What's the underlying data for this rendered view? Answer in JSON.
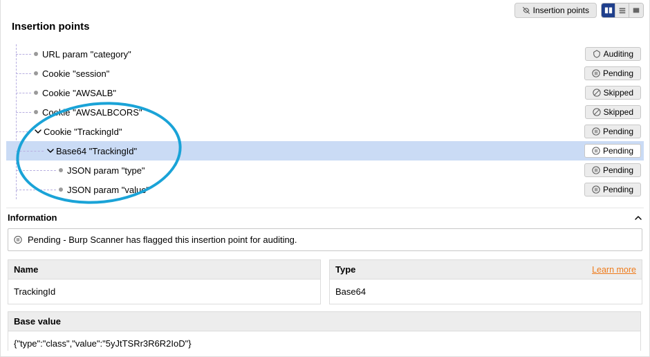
{
  "header": {
    "title": "Insertion points",
    "insertion_points_btn": "Insertion points"
  },
  "tree": [
    {
      "indent": 40,
      "dot": "gray",
      "caret": false,
      "label": "URL param \"category\"",
      "status": "Auditing",
      "status_icon": "auditing"
    },
    {
      "indent": 40,
      "dot": "gray",
      "caret": false,
      "label": "Cookie \"session\"",
      "status": "Pending",
      "status_icon": "pending"
    },
    {
      "indent": 40,
      "dot": "gray",
      "caret": false,
      "label": "Cookie \"AWSALB\"",
      "status": "Skipped",
      "status_icon": "skipped"
    },
    {
      "indent": 40,
      "dot": "gray",
      "caret": false,
      "label": "Cookie \"AWSALBCORS\"",
      "status": "Skipped",
      "status_icon": "skipped"
    },
    {
      "indent": 40,
      "dot": "purple",
      "caret": true,
      "label": "Cookie \"TrackingId\"",
      "status": "Pending",
      "status_icon": "pending"
    },
    {
      "indent": 58,
      "dot": "purple",
      "caret": true,
      "label": "Base64 \"TrackingId\"",
      "status": "Pending",
      "status_icon": "pending",
      "highlight": true
    },
    {
      "indent": 76,
      "dot": "gray",
      "caret": false,
      "label": "JSON param \"type\"",
      "status": "Pending",
      "status_icon": "pending"
    },
    {
      "indent": 76,
      "dot": "gray",
      "caret": false,
      "label": "JSON param \"value\"",
      "status": "Pending",
      "status_icon": "pending"
    }
  ],
  "info": {
    "header": "Information",
    "pending_msg": "Pending - Burp Scanner has flagged this insertion point for auditing.",
    "name_label": "Name",
    "name_value": "TrackingId",
    "type_label": "Type",
    "type_value": "Base64",
    "learn_more": "Learn more",
    "base_label": "Base value",
    "base_value": "{\"type\":\"class\",\"value\":\"5yJtTSRr3R6R2IoD\"}"
  }
}
